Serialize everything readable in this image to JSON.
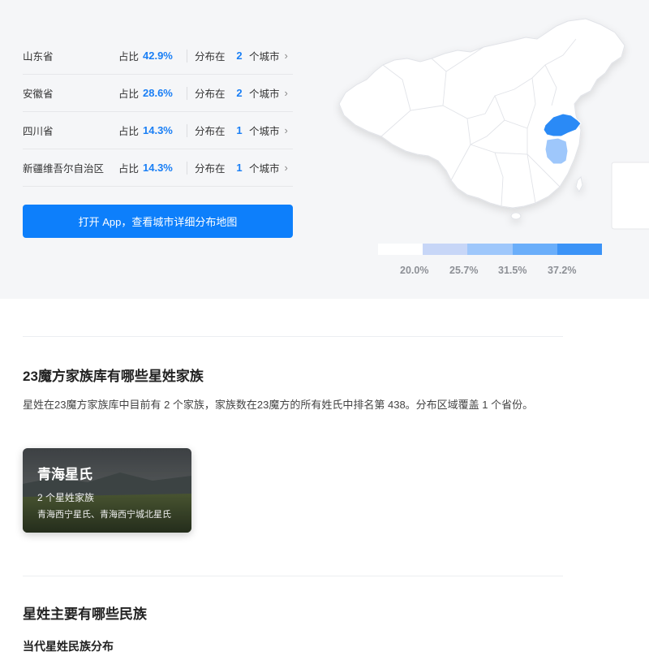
{
  "provinces": [
    {
      "name": "山东省",
      "ratio_label": "占比",
      "ratio": "42.9%",
      "dist_label": "分布在",
      "cities": "2",
      "unit": "个城市"
    },
    {
      "name": "安徽省",
      "ratio_label": "占比",
      "ratio": "28.6%",
      "dist_label": "分布在",
      "cities": "2",
      "unit": "个城市"
    },
    {
      "name": "四川省",
      "ratio_label": "占比",
      "ratio": "14.3%",
      "dist_label": "分布在",
      "cities": "1",
      "unit": "个城市"
    },
    {
      "name": "新疆维吾尔自治区",
      "ratio_label": "占比",
      "ratio": "14.3%",
      "dist_label": "分布在",
      "cities": "1",
      "unit": "个城市"
    }
  ],
  "open_button": "打开 App，查看城市详细分布地图",
  "legend": {
    "labels": [
      "20.0%",
      "25.7%",
      "31.5%",
      "37.2%"
    ],
    "colors": [
      "#ffffff",
      "#c7d6f7",
      "#9ec7fb",
      "#6aaefa",
      "#3b93f7"
    ]
  },
  "map_colors": {
    "base": "#ffffff",
    "shandong": "#2b8af6",
    "anhui": "#9ec7fb",
    "border": "#e1e3e8"
  },
  "family_section": {
    "title": "23魔方家族库有哪些星姓家族",
    "description": "星姓在23魔方家族库中目前有 2 个家族，家族数在23魔方的所有姓氏中排名第 438。分布区域覆盖 1 个省份。",
    "card": {
      "title": "青海星氏",
      "count": "2 个星姓家族",
      "places": "青海西宁星氏、青海西宁城北星氏"
    }
  },
  "ethnic_section": {
    "title": "星姓主要有哪些民族",
    "subtitle": "当代星姓民族分布"
  }
}
